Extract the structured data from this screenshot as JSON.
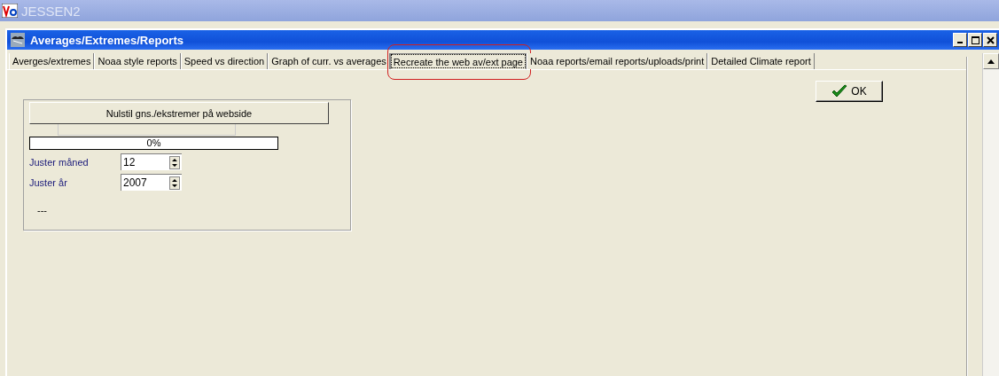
{
  "app_window": {
    "title": "JESSEN2"
  },
  "window": {
    "title": "Averages/Extremes/Reports"
  },
  "tabs": [
    {
      "label": "Averges/extremes",
      "selected": false
    },
    {
      "label": "Noaa style reports",
      "selected": false
    },
    {
      "label": "Speed vs direction",
      "selected": false
    },
    {
      "label": "Graph of curr. vs averages",
      "selected": false
    },
    {
      "label": "Recreate the web av/ext page",
      "selected": true,
      "highlighted": true
    },
    {
      "label": "Noaa reports/email reports/uploads/print",
      "selected": false
    },
    {
      "label": "Detailed Climate report",
      "selected": false
    }
  ],
  "ok_button": {
    "label": "OK"
  },
  "panel": {
    "reset_button": {
      "label": "Nulstil gns./ekstremer på webside"
    },
    "progress": {
      "level": 0,
      "reading": "0%"
    },
    "fields": [
      {
        "label": "Juster måned",
        "value": "12"
      },
      {
        "label": "Juster år",
        "value": "2007"
      }
    ],
    "status": "---"
  }
}
